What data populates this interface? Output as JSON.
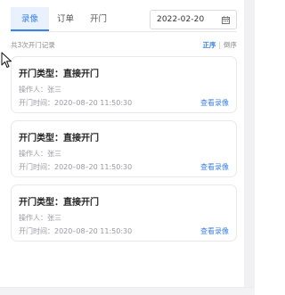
{
  "tabs": [
    {
      "label": "录像",
      "active": true
    },
    {
      "label": "订单",
      "active": false
    },
    {
      "label": "开门",
      "active": false
    }
  ],
  "date_picker": {
    "value": "2022-02-20",
    "icon": "calendar-icon"
  },
  "summary": {
    "count_text": "共3次开门记录",
    "sort_asc": "正序",
    "sort_sep": "|",
    "sort_desc": "倒序"
  },
  "records": [
    {
      "title": "开门类型：直接开门",
      "operator": "操作人：张三",
      "time": "开门时间：2020–08–20 11:50:30",
      "link": "查看录像"
    },
    {
      "title": "开门类型：直接开门",
      "operator": "操作人：张三",
      "time": "开门时间：2020–08–20 11:50:30",
      "link": "查看录像"
    },
    {
      "title": "开门类型：直接开门",
      "operator": "操作人：张三",
      "time": "开门时间：2020–08–20 11:50:30",
      "link": "查看录像"
    }
  ],
  "colors": {
    "accent": "#3b82e8",
    "tab_active_bg": "#e8f1fc",
    "muted_text": "#9a9a9f"
  }
}
